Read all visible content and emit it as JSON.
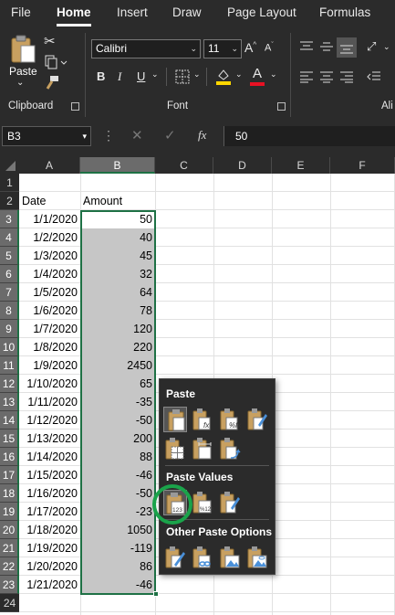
{
  "ribbon": {
    "tabs": [
      "File",
      "Home",
      "Insert",
      "Draw",
      "Page Layout",
      "Formulas"
    ],
    "paste_label": "Paste",
    "group_clipboard": "Clipboard",
    "group_font": "Font",
    "group_alignment_partial": "Ali",
    "font_name": "Calibri",
    "font_size": "11",
    "font_grow": "A",
    "font_shrink": "A",
    "bold": "B",
    "italic": "I",
    "underline": "U",
    "font_color_letter": "A",
    "highlight_color": "#ffd700",
    "font_color": "#e81123"
  },
  "formula_bar": {
    "name_box": "B3",
    "fx_label": "fx",
    "value": "50"
  },
  "grid": {
    "columns": [
      "A",
      "B",
      "C",
      "D",
      "E",
      "F"
    ],
    "rows": [
      "1",
      "2",
      "3",
      "4",
      "5",
      "6",
      "7",
      "8",
      "9",
      "10",
      "11",
      "12",
      "13",
      "14",
      "15",
      "16",
      "17",
      "18",
      "19",
      "20",
      "21",
      "22",
      "23",
      "24"
    ],
    "header_date": "Date",
    "header_amount": "Amount",
    "dates": [
      "1/1/2020",
      "1/2/2020",
      "1/3/2020",
      "1/4/2020",
      "1/5/2020",
      "1/6/2020",
      "1/7/2020",
      "1/8/2020",
      "1/9/2020",
      "1/10/2020",
      "1/11/2020",
      "1/12/2020",
      "1/13/2020",
      "1/14/2020",
      "1/15/2020",
      "1/16/2020",
      "1/17/2020",
      "1/18/2020",
      "1/19/2020",
      "1/20/2020",
      "1/21/2020"
    ],
    "amounts": [
      "50",
      "40",
      "45",
      "32",
      "64",
      "78",
      "120",
      "220",
      "2450",
      "65",
      "-35",
      "-50",
      "200",
      "88",
      "-46",
      "-50",
      "-23",
      "1050",
      "-119",
      "86",
      "-46"
    ],
    "selection_color": "#1e7145"
  },
  "paste_menu": {
    "section_paste": "Paste",
    "section_values": "Paste Values",
    "section_other": "Other Paste Options",
    "values_badge": "123",
    "highlight_color": "#1aa34a"
  }
}
